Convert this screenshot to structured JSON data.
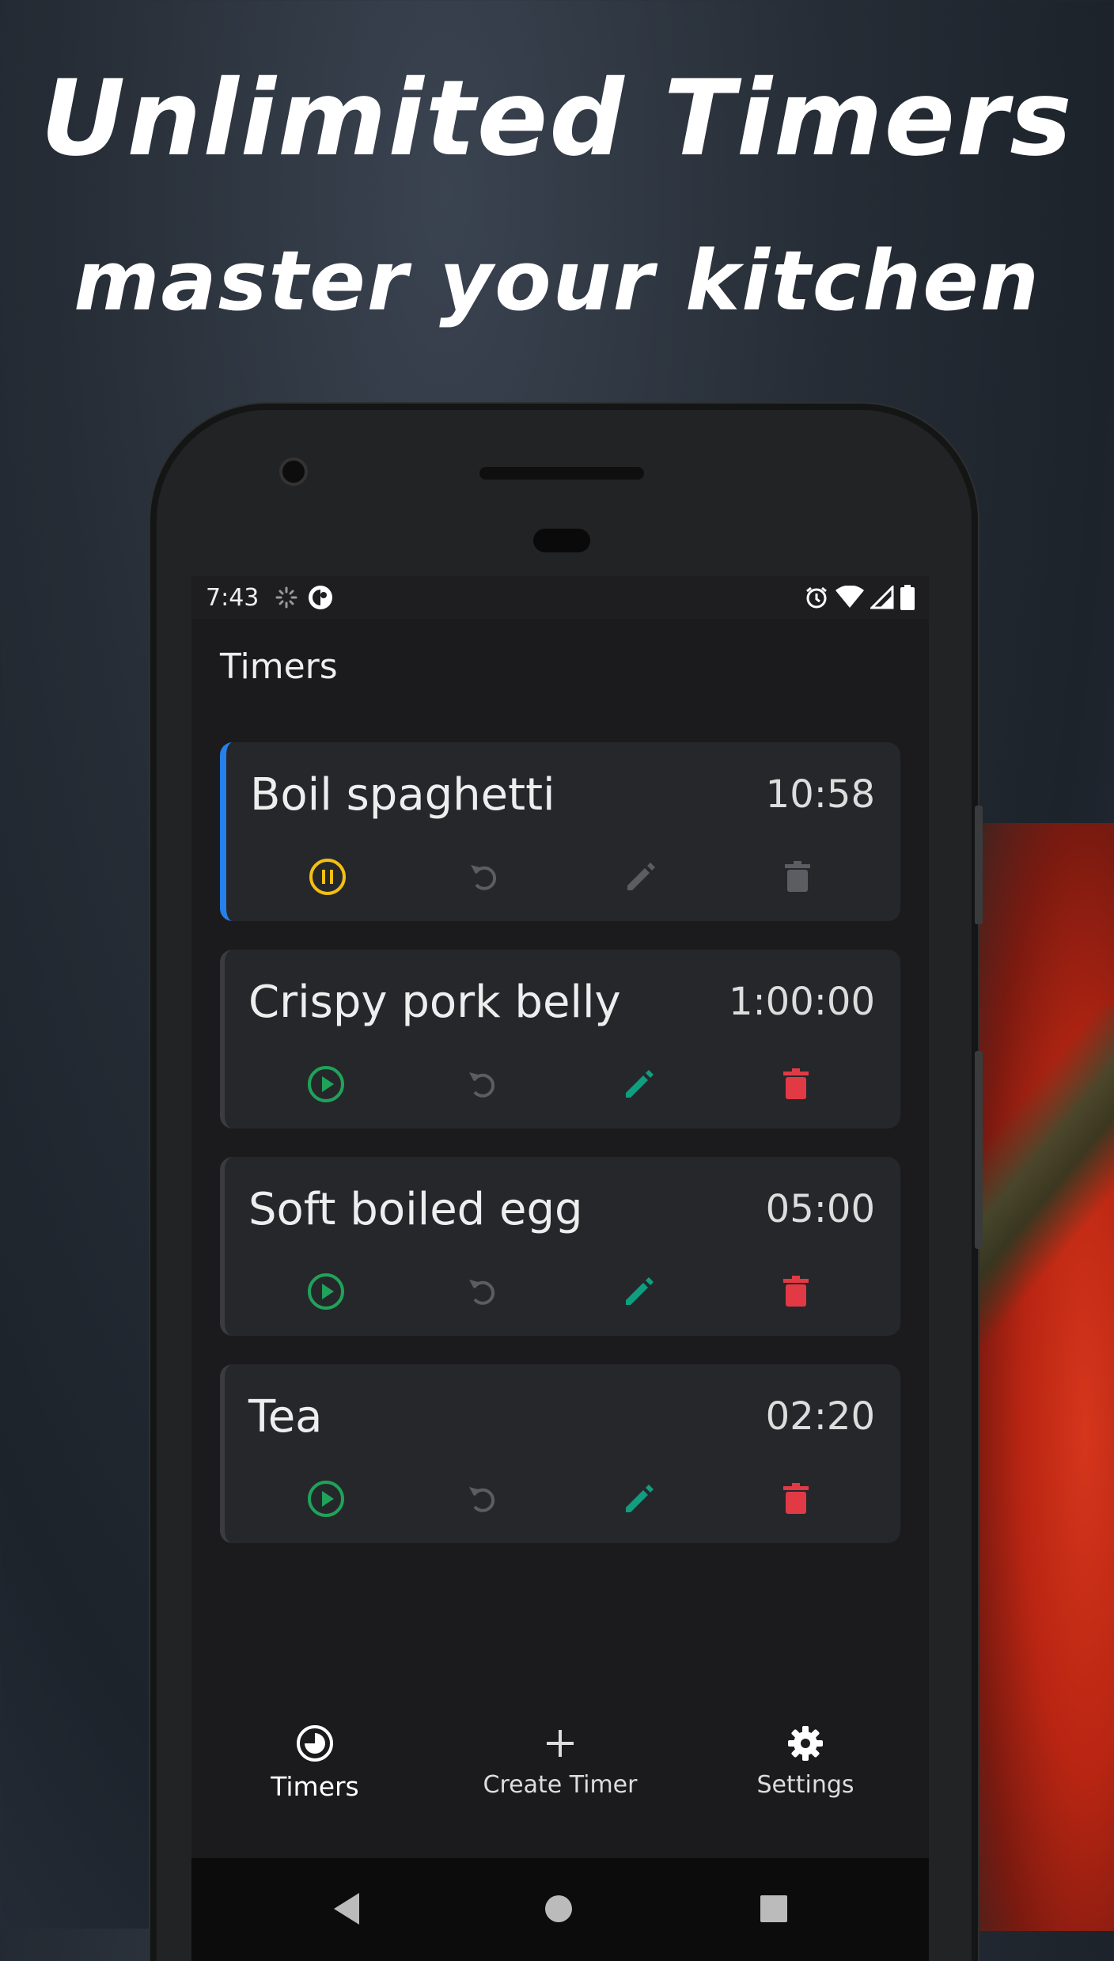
{
  "headline": {
    "title": "Unlimited Timers",
    "subtitle": "master your kitchen"
  },
  "status_bar": {
    "time": "7:43"
  },
  "app_bar": {
    "title": "Timers"
  },
  "timers": [
    {
      "name": "Boil spaghetti",
      "time": "10:58",
      "state": "running"
    },
    {
      "name": "Crispy pork belly",
      "time": "1:00:00",
      "state": "idle"
    },
    {
      "name": "Soft boiled egg",
      "time": "05:00",
      "state": "idle"
    },
    {
      "name": "Tea",
      "time": "02:20",
      "state": "idle"
    }
  ],
  "bottom_nav": {
    "timers_label": "Timers",
    "create_label": "Create Timer",
    "settings_label": "Settings"
  },
  "colors": {
    "active_accent": "#2680eb",
    "pause": "#f2c014",
    "play": "#1fa35a",
    "edit": "#0f9e7f",
    "delete": "#e23a45",
    "disabled": "#5c5d62"
  }
}
